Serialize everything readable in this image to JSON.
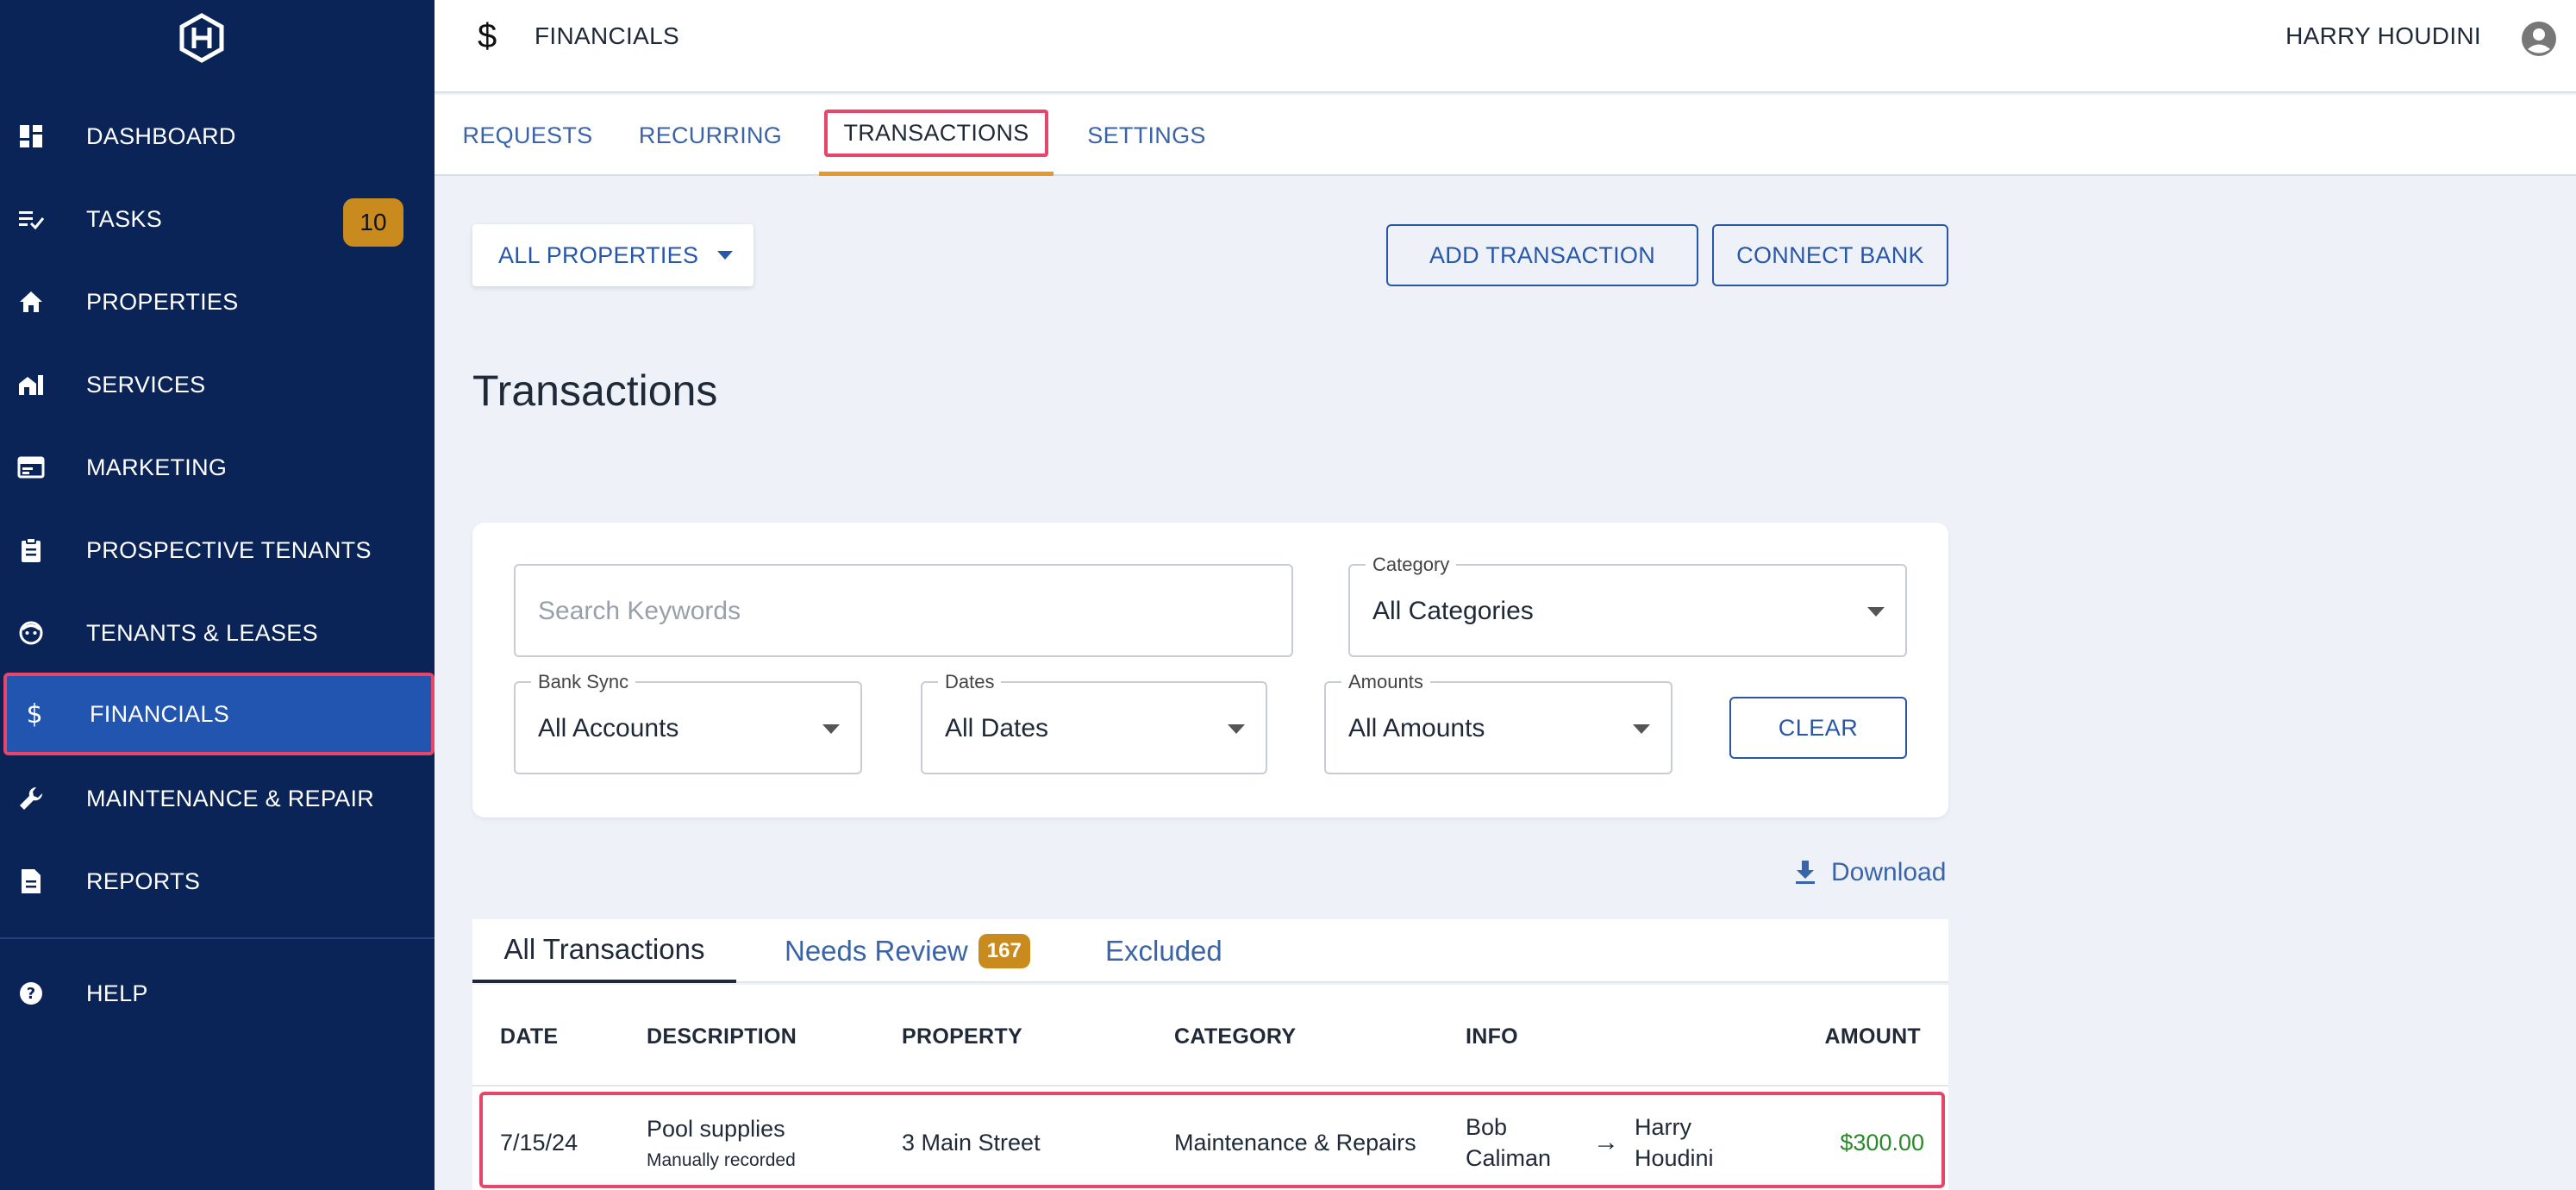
{
  "header": {
    "section_title": "FINANCIALS",
    "user_name": "HARRY HOUDINI"
  },
  "sidebar": {
    "items": [
      {
        "label": "DASHBOARD",
        "icon": "dashboard-icon"
      },
      {
        "label": "TASKS",
        "icon": "tasks-icon",
        "badge": "10"
      },
      {
        "label": "PROPERTIES",
        "icon": "home-icon"
      },
      {
        "label": "SERVICES",
        "icon": "services-icon"
      },
      {
        "label": "MARKETING",
        "icon": "marketing-icon"
      },
      {
        "label": "PROSPECTIVE TENANTS",
        "icon": "clipboard-icon"
      },
      {
        "label": "TENANTS & LEASES",
        "icon": "tenant-face-icon"
      },
      {
        "label": "FINANCIALS",
        "icon": "dollar-icon",
        "active": true
      },
      {
        "label": "MAINTENANCE & REPAIR",
        "icon": "wrench-icon"
      },
      {
        "label": "REPORTS",
        "icon": "report-icon"
      }
    ],
    "help": {
      "label": "HELP",
      "icon": "help-icon"
    }
  },
  "tabs": [
    {
      "label": "REQUESTS"
    },
    {
      "label": "RECURRING"
    },
    {
      "label": "TRANSACTIONS",
      "active": true
    },
    {
      "label": "SETTINGS"
    }
  ],
  "toolbar": {
    "property_selector": "ALL PROPERTIES",
    "add_transaction": "ADD TRANSACTION",
    "connect_bank": "CONNECT BANK"
  },
  "page_title": "Transactions",
  "filters": {
    "search_placeholder": "Search Keywords",
    "category": {
      "label": "Category",
      "value": "All Categories"
    },
    "bank_sync": {
      "label": "Bank Sync",
      "value": "All Accounts"
    },
    "dates": {
      "label": "Dates",
      "value": "All Dates"
    },
    "amounts": {
      "label": "Amounts",
      "value": "All Amounts"
    },
    "clear": "CLEAR"
  },
  "download_label": "Download",
  "subtabs": {
    "all": "All Transactions",
    "review": "Needs Review",
    "review_count": "167",
    "excluded": "Excluded"
  },
  "table": {
    "columns": {
      "date": "DATE",
      "description": "DESCRIPTION",
      "property": "PROPERTY",
      "category": "CATEGORY",
      "info": "INFO",
      "amount": "AMOUNT"
    },
    "rows": [
      {
        "date": "7/15/24",
        "description": "Pool supplies",
        "note": "Manually recorded",
        "property": "3 Main Street",
        "category": "Maintenance & Repairs",
        "from_1": "Bob",
        "from_2": "Caliman",
        "to_1": "Harry",
        "to_2": "Houdini",
        "amount": "$300.00"
      }
    ]
  },
  "colors": {
    "sidebar_bg": "#0a2458",
    "sidebar_active": "#2255b0",
    "accent_blue": "#2757a8",
    "badge": "#c98b1e",
    "highlight": "#e8456b",
    "amount_green": "#2a8a2a"
  }
}
